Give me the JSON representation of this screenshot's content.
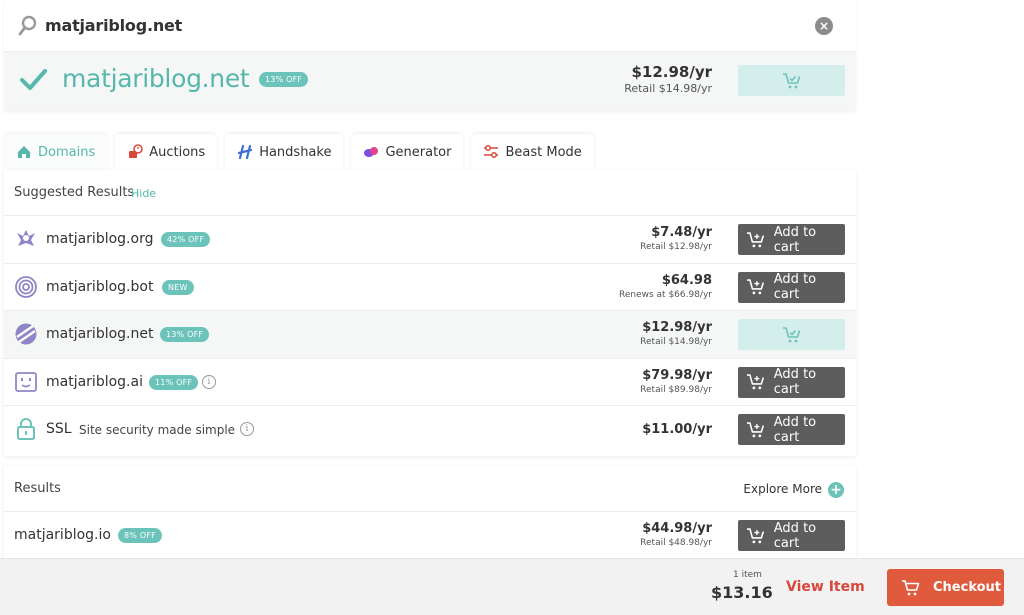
{
  "search": {
    "query": "matjariblog.net",
    "clear_icon": "close-circle-icon"
  },
  "hero": {
    "domain": "matjariblog.net",
    "badge": "13% OFF",
    "price": "$12.98/yr",
    "retail": "Retail $14.98/yr",
    "status": "added-to-cart",
    "accent_color": "#56b7ad"
  },
  "tabs": [
    {
      "label": "Domains",
      "icon": "home-icon",
      "active": true
    },
    {
      "label": "Auctions",
      "icon": "auction-icon",
      "active": false
    },
    {
      "label": "Handshake",
      "icon": "handshake-icon",
      "active": false
    },
    {
      "label": "Generator",
      "icon": "generator-icon",
      "active": false
    },
    {
      "label": "Beast Mode",
      "icon": "sliders-icon",
      "active": false
    }
  ],
  "suggested": {
    "title": "Suggested Results",
    "hide_label": "Hide",
    "rows": [
      {
        "domain": "matjariblog.org",
        "badge": "42% OFF",
        "price": "$7.48/yr",
        "retail": "Retail $12.98/yr",
        "button": "Add to cart",
        "icon": "org-tld-icon"
      },
      {
        "domain": "matjariblog.bot",
        "badge": "NEW",
        "price": "$64.98",
        "retail": "Renews at $66.98/yr",
        "button": "Add to cart",
        "icon": "target-icon"
      },
      {
        "domain": "matjariblog.net",
        "badge": "13% OFF",
        "price": "$12.98/yr",
        "retail": "Retail $14.98/yr",
        "button": "",
        "icon": "net-tld-icon"
      },
      {
        "domain": "matjariblog.ai",
        "badge": "11% OFF",
        "price": "$79.98/yr",
        "retail": "Retail $89.98/yr",
        "button": "Add to cart",
        "icon": "robot-icon"
      },
      {
        "domain": "SSL",
        "subtitle": "Site security made simple",
        "price": "$11.00/yr",
        "button": "Add to cart",
        "icon": "lock-icon"
      }
    ]
  },
  "results": {
    "title": "Results",
    "explore_label": "Explore More",
    "rows": [
      {
        "domain": "matjariblog.io",
        "badge": "8% OFF",
        "price": "$44.98/yr",
        "retail": "Retail $48.98/yr",
        "button": "Add to cart"
      }
    ]
  },
  "footer": {
    "count": "1 item",
    "total": "$13.16",
    "view_label": "View Item",
    "checkout_label": "Checkout",
    "checkout_color": "#e05a3d"
  }
}
